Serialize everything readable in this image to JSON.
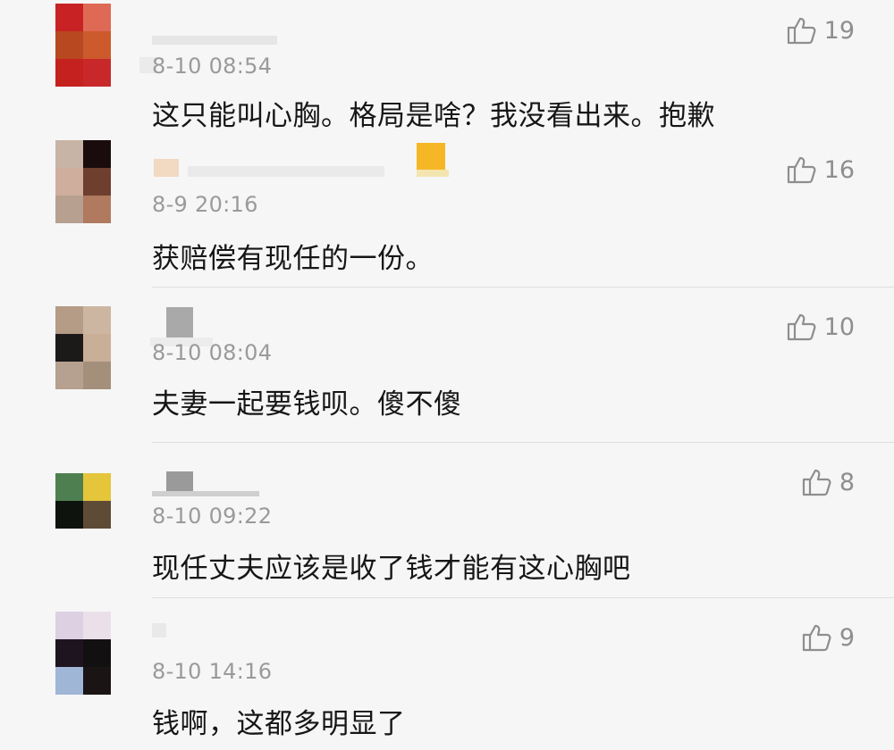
{
  "comments": [
    {
      "time": "8-10 08:54",
      "text": "这只能叫心胸。格局是啥？我没看出来。抱歉",
      "likes": "19",
      "avatar_colors": [
        "#c82224",
        "#de6a55",
        "#b8481f",
        "#cc5a2c",
        "#c4211f",
        "#c8282a"
      ]
    },
    {
      "time": "8-9 20:16",
      "text": "获赔偿有现任的一份。",
      "likes": "16",
      "avatar_colors": [
        "#c8b4a6",
        "#1a0c0c",
        "#cfae9e",
        "#6e3f2e",
        "#b7a090",
        "#b07a5e"
      ]
    },
    {
      "time": "8-10 08:04",
      "text": "夫妻一起要钱呗。傻不傻",
      "likes": "10",
      "avatar_colors": [
        "#b59c86",
        "#cdb6a1",
        "#1c1919",
        "#c9ae98",
        "#b6a08f",
        "#a48f7b"
      ]
    },
    {
      "time": "8-10 09:22",
      "text": "现任丈夫应该是收了钱才能有这心胸吧",
      "likes": "8",
      "avatar_colors": [
        "#4e7f50",
        "#e5c53a",
        "#0e130d",
        "#5e4b35"
      ]
    },
    {
      "time": "8-10 14:16",
      "text": "钱啊，这都多明显了",
      "likes": "9",
      "avatar_colors": [
        "#ddd0e2",
        "#ebe0ea",
        "#1e1420",
        "#121010",
        "#9fb6d6",
        "#1a1415"
      ]
    }
  ]
}
